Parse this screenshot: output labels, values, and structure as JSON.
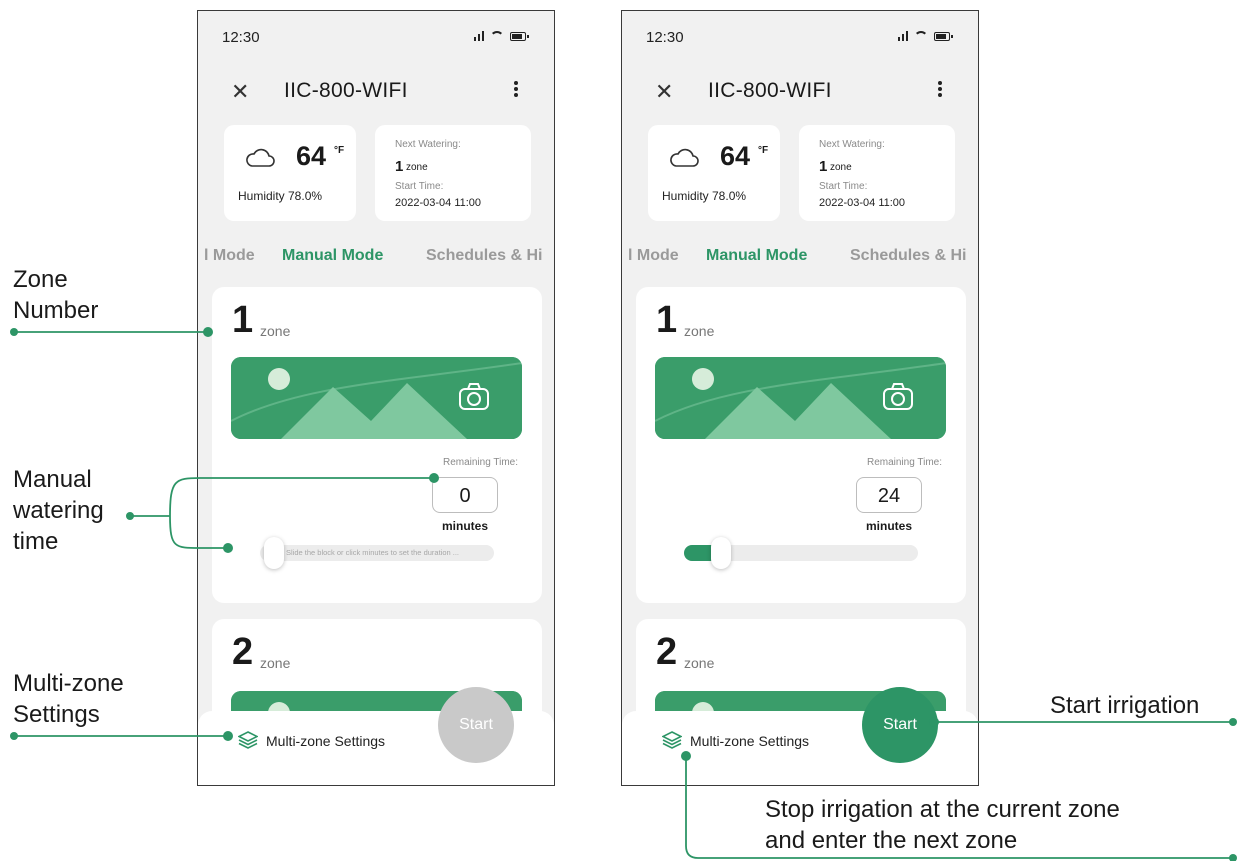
{
  "colors": {
    "accent": "#2d9566",
    "annotation_line": "#2d9566",
    "disabled": "#c9c9c9"
  },
  "status_bar": {
    "time": "12:30"
  },
  "app": {
    "title": "IIC-800-WIFI",
    "close_icon": "close-icon",
    "more_icon": "more-vertical-icon"
  },
  "weather": {
    "icon": "cloud-icon",
    "temperature": "64",
    "unit": "°F",
    "humidity": "Humidity  78.0%"
  },
  "next_watering": {
    "label": "Next Watering:",
    "zone_number": "1",
    "zone_word": "zone",
    "start_label": "Start Time:",
    "start_value": "2022-03-04 11:00"
  },
  "tabs": [
    {
      "label": "l Mode",
      "active": false
    },
    {
      "label": "Manual Mode",
      "active": true
    },
    {
      "label": "Schedules & Hi",
      "active": false
    }
  ],
  "zones": [
    {
      "number": "1",
      "word": "zone",
      "image_icon": "camera-icon",
      "remaining_label": "Remaining Time:",
      "minutes_word": "minutes"
    },
    {
      "number": "2",
      "word": "zone"
    }
  ],
  "screens": {
    "left": {
      "remaining_value": "0",
      "slider_fraction": 0.0,
      "slider_hint": "Slide the block or click minutes to set the duration ...",
      "start_state": "disabled"
    },
    "right": {
      "remaining_value": "24",
      "slider_fraction": 0.16,
      "slider_hint": "",
      "start_state": "active"
    }
  },
  "bottom": {
    "multizone_label": "Multi-zone Settings",
    "multizone_icon": "layers-icon",
    "start_label": "Start"
  },
  "annotations": {
    "zone_number": "Zone\nNumber",
    "manual_time": "Manual\nwatering\ntime",
    "multizone": "Multi-zone\nSettings",
    "start": "Start irrigation",
    "stop": "Stop irrigation at the current zone\nand enter the next zone"
  }
}
